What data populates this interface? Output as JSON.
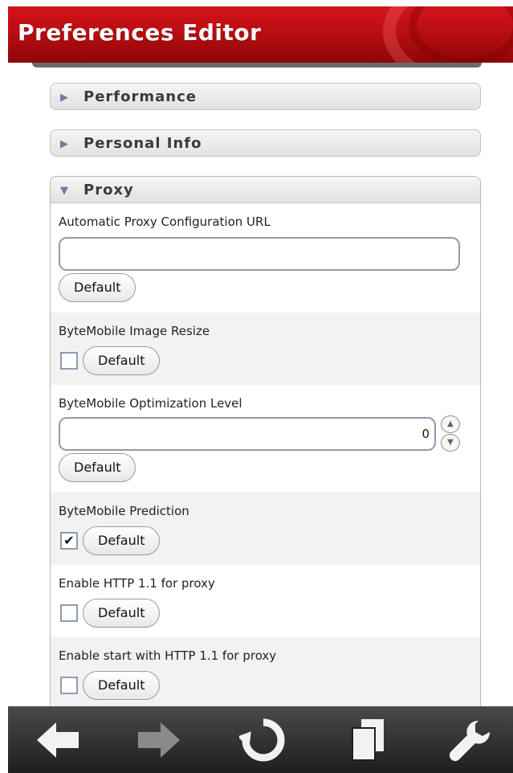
{
  "header": {
    "title": "Preferences Editor",
    "bar_color": "#c0101a"
  },
  "sections": [
    {
      "label": "Performance",
      "expanded": false
    },
    {
      "label": "Personal Info",
      "expanded": false
    },
    {
      "label": "Proxy",
      "expanded": true
    }
  ],
  "proxy": {
    "prefs": [
      {
        "label": "Automatic Proxy Configuration URL",
        "type": "text",
        "value": "",
        "button": "Default"
      },
      {
        "label": "ByteMobile Image Resize",
        "type": "checkbox",
        "checked": false,
        "button": "Default"
      },
      {
        "label": "ByteMobile Optimization Level",
        "type": "number",
        "value": "0",
        "button": "Default"
      },
      {
        "label": "ByteMobile Prediction",
        "type": "checkbox",
        "checked": true,
        "check_glyph": "✔",
        "button": "Default"
      },
      {
        "label": "Enable HTTP 1.1 for proxy",
        "type": "checkbox",
        "checked": false,
        "button": "Default"
      },
      {
        "label": "Enable start with HTTP 1.1 for proxy",
        "type": "checkbox",
        "checked": false,
        "button": "Default"
      }
    ]
  },
  "toolbar": {
    "icons": [
      "back-arrow-icon",
      "forward-arrow-icon",
      "reload-icon",
      "tabs-icon",
      "wrench-icon"
    ]
  }
}
